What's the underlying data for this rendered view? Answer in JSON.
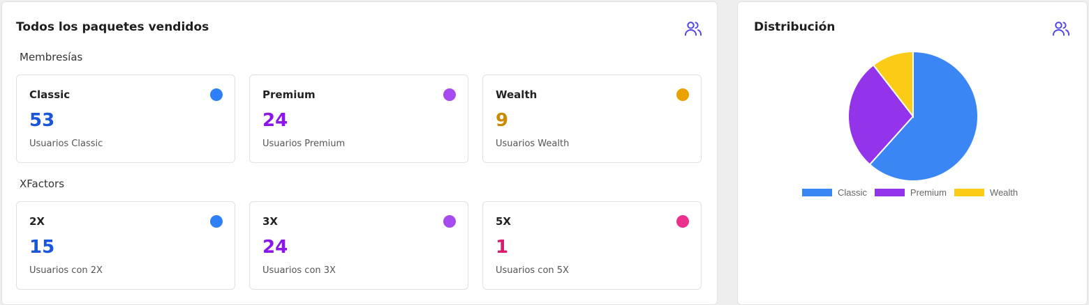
{
  "left_panel": {
    "title": "Todos los paquetes vendidos",
    "icon": "users-icon",
    "sections": [
      {
        "label": "Membresías",
        "cards": [
          {
            "name": "Classic",
            "count": "53",
            "sub": "Usuarios Classic",
            "color": "#2f7ff7",
            "count_color": "#1a56db"
          },
          {
            "name": "Premium",
            "count": "24",
            "sub": "Usuarios Premium",
            "color": "#a64bf0",
            "count_color": "#8a16e8"
          },
          {
            "name": "Wealth",
            "count": "9",
            "sub": "Usuarios Wealth",
            "color": "#e9a200",
            "count_color": "#c98a00"
          }
        ]
      },
      {
        "label": "XFactors",
        "cards": [
          {
            "name": "2X",
            "count": "15",
            "sub": "Usuarios con 2X",
            "color": "#2f7ff7",
            "count_color": "#1a56db"
          },
          {
            "name": "3X",
            "count": "24",
            "sub": "Usuarios con 3X",
            "color": "#a64bf0",
            "count_color": "#8a16e8"
          },
          {
            "name": "5X",
            "count": "1",
            "sub": "Usuarios con 5X",
            "color": "#ec2f8a",
            "count_color": "#db1a6b"
          }
        ]
      }
    ]
  },
  "right_panel": {
    "title": "Distribución",
    "icon": "users-icon"
  },
  "chart_data": {
    "type": "pie",
    "categories": [
      "Classic",
      "Premium",
      "Wealth"
    ],
    "values": [
      53,
      24,
      9
    ],
    "colors": [
      "#3b86f5",
      "#9333ea",
      "#facc15"
    ],
    "legend": "bottom"
  }
}
